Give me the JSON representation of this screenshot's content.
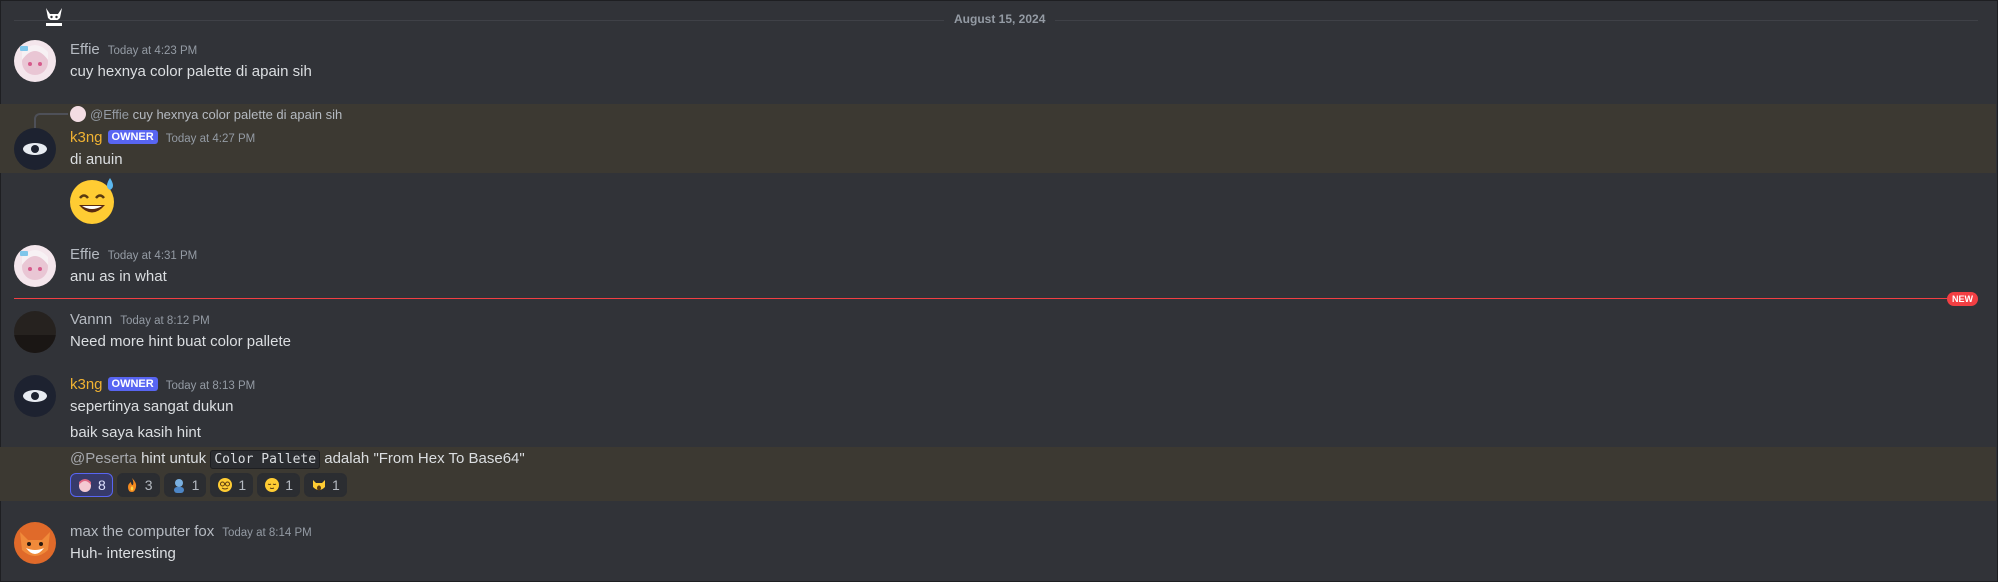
{
  "divider": {
    "date": "August 15, 2024"
  },
  "new_badge": "NEW",
  "messages": [
    {
      "author": "Effie",
      "time": "Today at 4:23 PM",
      "lines": [
        "cuy hexnya color palette di apain sih"
      ]
    },
    {
      "reply": {
        "mention": "@Effie",
        "text": "cuy hexnya color palette di apain sih"
      },
      "author": "k3ng",
      "role": "OWNER",
      "time": "Today at 4:27 PM",
      "lines": [
        "di anuin"
      ],
      "emoji": "sweat-smile-emoji"
    },
    {
      "author": "Effie",
      "time": "Today at 4:31 PM",
      "lines": [
        "anu as in what"
      ]
    },
    {
      "author": "Vannn",
      "time": "Today at 8:12 PM",
      "lines": [
        "Need more hint buat color pallete"
      ]
    },
    {
      "author": "k3ng",
      "role": "OWNER",
      "time": "Today at 8:13 PM",
      "lines": [
        "sepertinya sangat dukun",
        "baik saya kasih hint"
      ],
      "hint": {
        "mention": "@Peserta",
        "pre": " hint untuk ",
        "code": "Color Pallete",
        "post": " adalah \"From Hex To Base64\""
      },
      "reactions": [
        {
          "icon": "anime-girl-emoji",
          "count": "8"
        },
        {
          "icon": "fire-emoji",
          "count": "3"
        },
        {
          "icon": "person-emoji",
          "count": "1"
        },
        {
          "icon": "nerd-face-emoji",
          "count": "1"
        },
        {
          "icon": "relieved-face-emoji",
          "count": "1"
        },
        {
          "icon": "screaming-cat-emoji",
          "count": "1"
        }
      ]
    },
    {
      "author": "max the computer fox",
      "time": "Today at 8:14 PM",
      "lines": [
        "Huh- interesting"
      ]
    }
  ],
  "colors": {
    "background": "#313338",
    "owner_name": "#f0b232",
    "role_badge": "#5865f2",
    "new_line": "#f23f43",
    "highlight": "#3c3932"
  }
}
